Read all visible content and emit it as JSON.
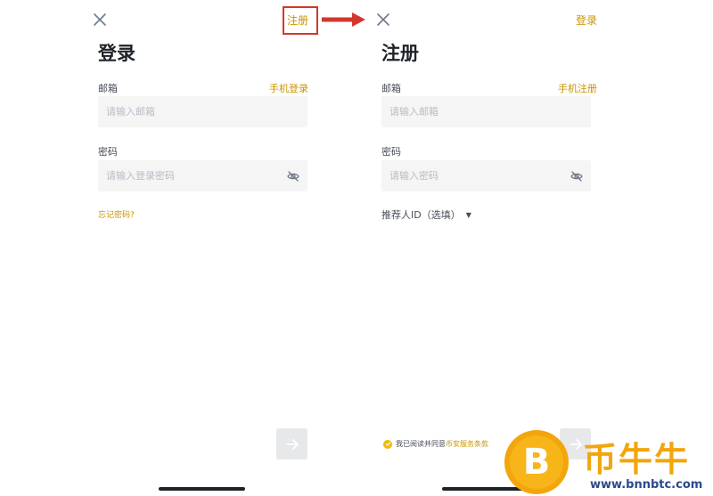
{
  "login": {
    "title": "登录",
    "top_link": "注册",
    "email_label": "邮箱",
    "phone_link": "手机登录",
    "email_placeholder": "请输入邮箱",
    "password_label": "密码",
    "password_placeholder": "请输入登录密码",
    "forgot_link": "忘记密码?"
  },
  "register": {
    "title": "注册",
    "top_link": "登录",
    "email_label": "邮箱",
    "phone_link": "手机注册",
    "email_placeholder": "请输入邮箱",
    "password_label": "密码",
    "password_placeholder": "请输入密码",
    "referral_label": "推荐人ID（选填）",
    "agree_text": "我已阅读并同意",
    "terms_link": "币安服务条款"
  },
  "watermark": {
    "coin_symbol": "B",
    "title": "币牛牛",
    "url": "www.bnnbtc.com"
  },
  "colors": {
    "accent": "#c99400",
    "highlight": "#d4372c",
    "input_bg": "#f5f5f5",
    "button_disabled": "#e6e8ea",
    "check": "#f0b90b"
  }
}
